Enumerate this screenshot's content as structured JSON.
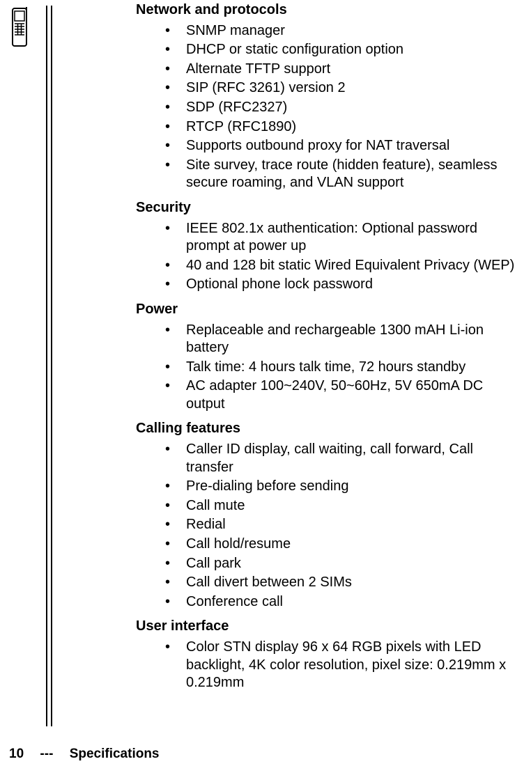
{
  "sections": [
    {
      "title": "Network and protocols",
      "items": [
        "SNMP manager",
        "DHCP or static configuration option",
        "Alternate TFTP support",
        "SIP (RFC 3261) version 2",
        "SDP (RFC2327)",
        "RTCP (RFC1890)",
        "Supports outbound proxy for NAT traversal",
        "Site survey, trace route (hidden feature), seamless secure roaming, and VLAN support"
      ]
    },
    {
      "title": "Security",
      "items": [
        "IEEE 802.1x authentication: Optional password prompt at power up",
        "40 and 128 bit static Wired Equivalent Privacy (WEP)",
        "Optional phone lock password"
      ]
    },
    {
      "title": "Power",
      "items": [
        "Replaceable and rechargeable 1300 mAH Li-ion battery",
        "Talk time: 4 hours talk time, 72 hours standby",
        "AC adapter 100~240V, 50~60Hz, 5V 650mA DC output"
      ]
    },
    {
      "title": "Calling features",
      "items": [
        "Caller ID display, call waiting, call forward, Call transfer",
        "Pre-dialing before sending",
        "Call mute",
        "Redial",
        "Call hold/resume",
        "Call park",
        "Call divert between 2 SIMs",
        "Conference call"
      ]
    },
    {
      "title": "User interface",
      "items": [
        "Color STN display 96 x 64 RGB pixels with LED backlight, 4K color resolution, pixel size: 0.219mm x 0.219mm"
      ]
    }
  ],
  "footer": {
    "page": "10",
    "separator": "---",
    "section_name": "Specifications"
  }
}
